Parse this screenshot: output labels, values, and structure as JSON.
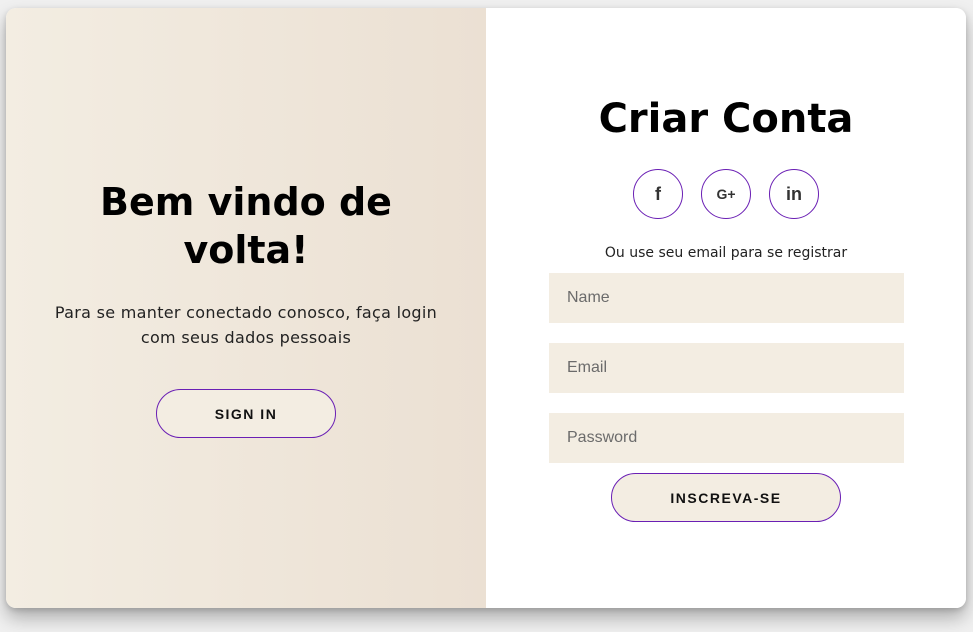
{
  "welcome": {
    "title": "Bem vindo de volta!",
    "text": "Para se manter conectado conosco, faça login com seus dados pessoais",
    "signin_label": "SIGN IN"
  },
  "signup": {
    "title": "Criar Conta",
    "social": {
      "facebook": "f",
      "google": "G+",
      "linkedin": "in"
    },
    "or_text": "Ou use seu email para se registrar",
    "name_placeholder": "Name",
    "email_placeholder": "Email",
    "password_placeholder": "Password",
    "button_label": "INSCREVA-SE"
  },
  "colors": {
    "accent": "#6a1fb4",
    "panel": "#f3ede2"
  }
}
